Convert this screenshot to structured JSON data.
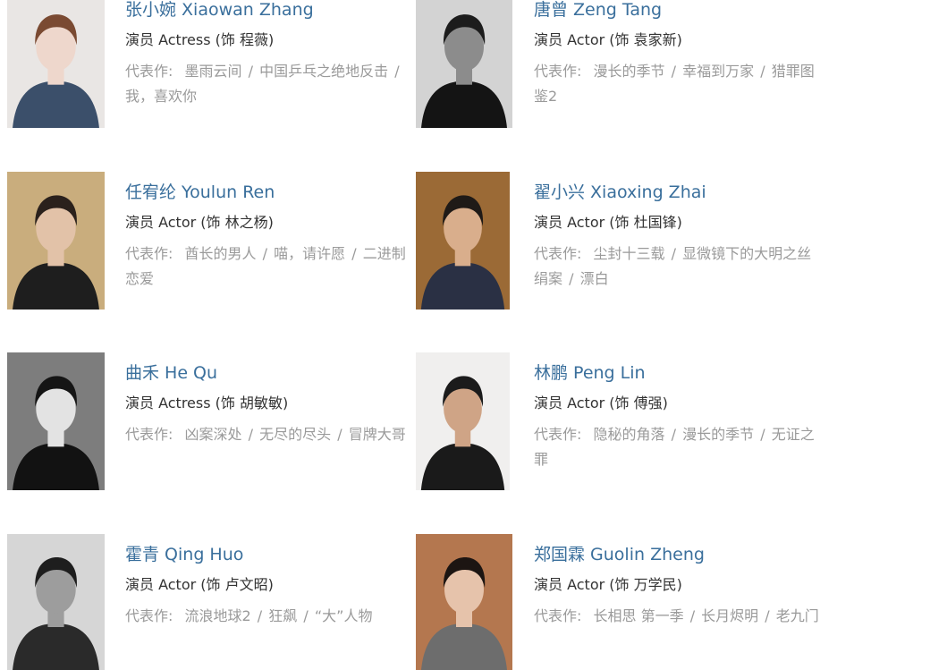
{
  "cast": [
    {
      "name": "张小婉 Xiaowan Zhang",
      "role_prefix": "演员 Actress (饰 ",
      "role_name": "程薇",
      "role_suffix": ")",
      "works_label": "代表作:",
      "works": [
        "墨雨云间",
        "中国乒乓之绝地反击",
        "我，喜欢你"
      ],
      "photo": {
        "bg": "#e9e6e4",
        "skin": "#eed7cc",
        "hair": "#7a4a32",
        "cloth": "#3b4f6a"
      }
    },
    {
      "name": "唐曾 Zeng Tang",
      "role_prefix": "演员 Actor (饰 ",
      "role_name": "袁家新",
      "role_suffix": ")",
      "works_label": "代表作:",
      "works": [
        "漫长的季节",
        "幸福到万家",
        "猎罪图鉴2"
      ],
      "photo": {
        "bg": "#d3d3d3",
        "skin": "#8c8c8c",
        "hair": "#1c1c1c",
        "cloth": "#141414"
      }
    },
    {
      "name": "任宥纶 Youlun Ren",
      "role_prefix": "演员 Actor (饰 ",
      "role_name": "林之杨",
      "role_suffix": ")",
      "works_label": "代表作:",
      "works": [
        "酋长的男人",
        "喵，请许愿",
        "二进制恋爱"
      ],
      "photo": {
        "bg": "#c9ad7d",
        "skin": "#e2c2a8",
        "hair": "#2a211c",
        "cloth": "#1e1e1e"
      }
    },
    {
      "name": "翟小兴 Xiaoxing Zhai",
      "role_prefix": "演员 Actor (饰 ",
      "role_name": "杜国锋",
      "role_suffix": ")",
      "works_label": "代表作:",
      "works": [
        "尘封十三载",
        "显微镜下的大明之丝绢案",
        "漂白"
      ],
      "photo": {
        "bg": "#9b6a36",
        "skin": "#d9ae8c",
        "hair": "#1f1a17",
        "cloth": "#2a3044"
      }
    },
    {
      "name": "曲禾 He Qu",
      "role_prefix": "演员 Actress (饰 ",
      "role_name": "胡敏敏",
      "role_suffix": ")",
      "works_label": "代表作:",
      "works": [
        "凶案深处",
        "无尽的尽头",
        "冒牌大哥"
      ],
      "photo": {
        "bg": "#7d7d7d",
        "skin": "#e3e3e3",
        "hair": "#151515",
        "cloth": "#121212"
      }
    },
    {
      "name": "林鹏 Peng Lin",
      "role_prefix": "演员 Actor (饰 ",
      "role_name": "傅强",
      "role_suffix": ")",
      "works_label": "代表作:",
      "works": [
        "隐秘的角落",
        "漫长的季节",
        "无证之罪"
      ],
      "photo": {
        "bg": "#f0efee",
        "skin": "#cfa486",
        "hair": "#1b1b1b",
        "cloth": "#1a1a1a"
      }
    },
    {
      "name": "霍青 Qing Huo",
      "role_prefix": "演员 Actor (饰 ",
      "role_name": "卢文昭",
      "role_suffix": ")",
      "works_label": "代表作:",
      "works": [
        "流浪地球2",
        "狂飙",
        "“大”人物"
      ],
      "photo": {
        "bg": "#d6d6d6",
        "skin": "#9d9d9d",
        "hair": "#1e1e1e",
        "cloth": "#2a2a2a"
      }
    },
    {
      "name": "郑国霖 Guolin Zheng",
      "role_prefix": "演员 Actor (饰 ",
      "role_name": "万学民",
      "role_suffix": ")",
      "works_label": "代表作:",
      "works": [
        "长相思 第一季",
        "长月烬明",
        "老九门"
      ],
      "photo": {
        "bg": "#b4774f",
        "skin": "#e6c3ab",
        "hair": "#1c1512",
        "cloth": "#6d6d6d"
      }
    }
  ]
}
